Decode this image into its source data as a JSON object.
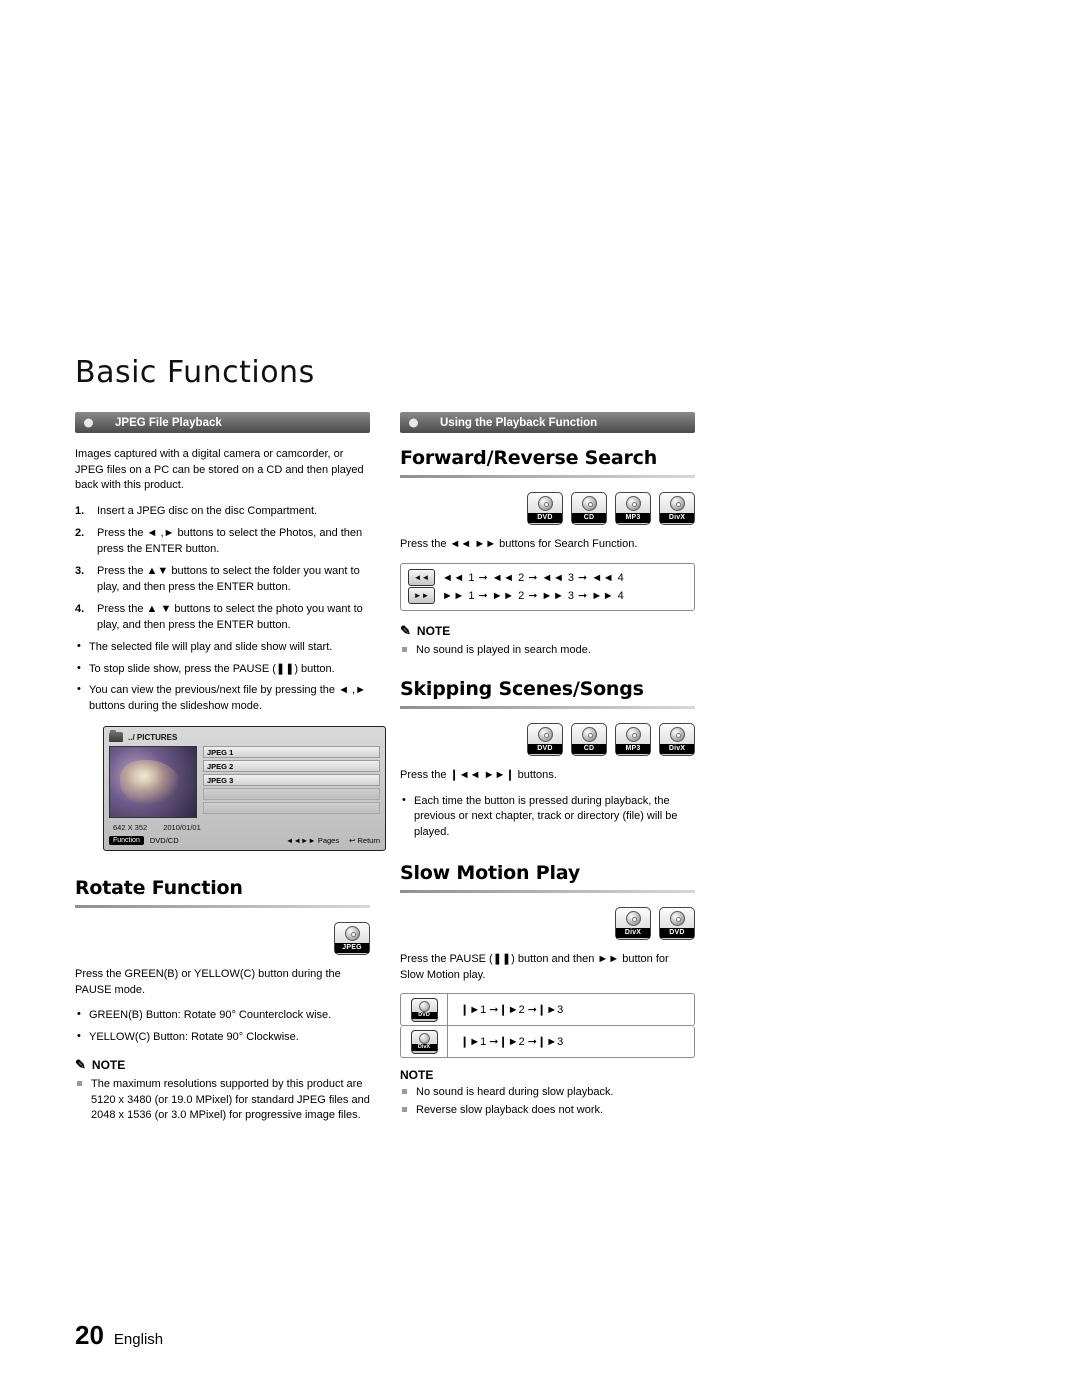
{
  "chapter": {
    "title": "Basic Functions"
  },
  "left": {
    "banner": {
      "label": "JPEG File Playback"
    },
    "intro": "Images captured with a digital camera or camcorder, or JPEG files on a PC can be stored on a CD and then played back with this product.",
    "steps": [
      {
        "num": "1.",
        "text": "Insert a JPEG disc on the disc Compartment."
      },
      {
        "num": "2.",
        "text": "Press the ◄ ,► buttons to select the Photos, and then press the ENTER button."
      },
      {
        "num": "3.",
        "text": "Press the ▲▼ buttons to select the folder you want to play, and then press the ENTER button."
      },
      {
        "num": "4.",
        "text": "Press the ▲ ▼ buttons to select the photo you want to play, and then press the ENTER button."
      }
    ],
    "bullets": [
      "The selected file will play and slide show will start.",
      "To stop slide show, press the PAUSE (❚❚) button.",
      "You can view the previous/next file by pressing the ◄ ,► buttons during the slideshow mode."
    ],
    "screen": {
      "path": "../ PICTURES",
      "files": [
        "JPEG 1",
        "JPEG 2",
        "JPEG 3"
      ],
      "resolution": "642 X 352",
      "date": "2010/01/01",
      "function_tag": "Function",
      "function_value": "DVD/CD",
      "pages_label": "Pages",
      "return_label": "Return"
    },
    "rotate": {
      "title": "Rotate Function",
      "badge": "JPEG",
      "intro": "Press  the GREEN(B) or YELLOW(C) button during the PAUSE mode.",
      "bullets": [
        "GREEN(B) Button: Rotate 90° Counterclock wise.",
        "YELLOW(C) Button: Rotate 90° Clockwise."
      ],
      "note_label": "NOTE",
      "note_items": [
        "The maximum resolutions supported by this product are 5120 x 3480 (or 19.0 MPixel) for standard JPEG files and 2048 x 1536 (or 3.0 MPixel) for progressive image files."
      ]
    }
  },
  "right": {
    "banner": {
      "label": "Using the Playback Function"
    },
    "search": {
      "title": "Forward/Reverse Search",
      "badges": [
        "DVD",
        "CD",
        "MP3",
        "DivX"
      ],
      "intro": "Press the ◄◄ ►► buttons for Search Function.",
      "rows": [
        {
          "key": "◄◄",
          "seq": "◄◄ 1 ➞ ◄◄ 2 ➞ ◄◄ 3 ➞ ◄◄ 4"
        },
        {
          "key": "►►",
          "seq": "►► 1 ➞ ►► 2 ➞ ►► 3 ➞ ►► 4"
        }
      ],
      "note_label": "NOTE",
      "note_items": [
        "No sound is played in search mode."
      ]
    },
    "skipping": {
      "title": "Skipping Scenes/Songs",
      "badges": [
        "DVD",
        "CD",
        "MP3",
        "DivX"
      ],
      "intro": "Press the ❙◄◄ ►►❙ buttons.",
      "bullets": [
        "Each time the button is pressed during playback, the previous or next chapter, track or directory (file) will be played."
      ]
    },
    "slow": {
      "title": "Slow Motion Play",
      "badges": [
        "DivX",
        "DVD"
      ],
      "intro": "Press the PAUSE (❚❚) button and then ►► button for Slow Motion play.",
      "rows": [
        {
          "key": "DVD",
          "seq": "❙►1 ➞❙►2 ➞❙►3"
        },
        {
          "key": "DivX",
          "seq": "❙►1 ➞❙►2 ➞❙►3"
        }
      ],
      "note_label": "NOTE",
      "note_items": [
        "No sound is heard during slow playback.",
        "Reverse slow playback does not work."
      ]
    }
  },
  "footer": {
    "page": "20",
    "language": "English"
  }
}
